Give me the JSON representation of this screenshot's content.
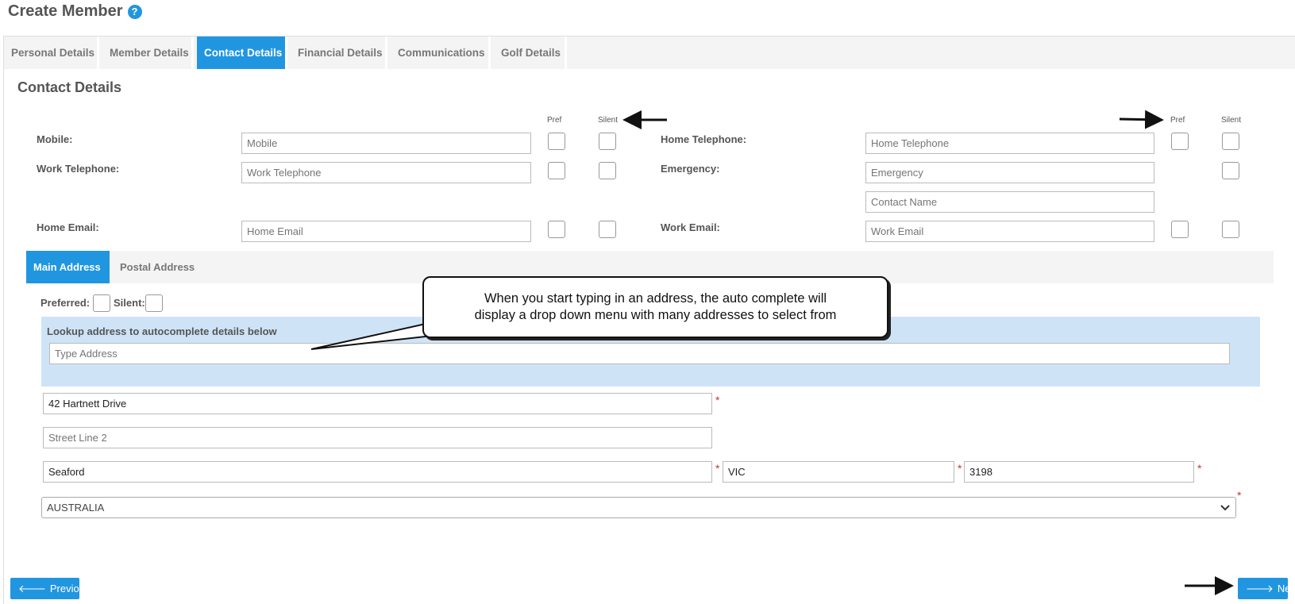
{
  "header": {
    "title": "Create Member",
    "help_icon": "question-circle-icon"
  },
  "tabs": [
    {
      "label": "Personal Details",
      "active": false
    },
    {
      "label": "Member Details",
      "active": false
    },
    {
      "label": "Contact Details",
      "active": true
    },
    {
      "label": "Financial Details",
      "active": false
    },
    {
      "label": "Communications",
      "active": false
    },
    {
      "label": "Golf Details",
      "active": false
    }
  ],
  "section_title": "Contact Details",
  "columns": {
    "pref": "Pref",
    "silent": "Silent"
  },
  "contact": {
    "mobile": {
      "label": "Mobile:",
      "placeholder": "Mobile"
    },
    "work_telephone": {
      "label": "Work Telephone:",
      "placeholder": "Work Telephone"
    },
    "home_email": {
      "label": "Home Email:",
      "placeholder": "Home Email"
    },
    "home_telephone": {
      "label": "Home Telephone:",
      "placeholder": "Home Telephone"
    },
    "emergency": {
      "label": "Emergency:",
      "placeholder": "Emergency",
      "contact_name_placeholder": "Contact Name"
    },
    "work_email": {
      "label": "Work Email:",
      "placeholder": "Work Email"
    }
  },
  "address_tabs": [
    {
      "label": "Main Address",
      "active": true
    },
    {
      "label": "Postal Address",
      "active": false
    }
  ],
  "address": {
    "preferred_label": "Preferred:",
    "silent_label": "Silent:",
    "lookup_label": "Lookup address to autocomplete details below",
    "lookup_placeholder": "Type Address",
    "street1": "42 Hartnett Drive",
    "street2_placeholder": "Street Line 2",
    "suburb": "Seaford",
    "state": "VIC",
    "postcode": "3198",
    "country": "AUSTRALIA",
    "required_mark": "*"
  },
  "callout": {
    "line1": "When you start typing in an address, the auto complete will",
    "line2": "display a drop down menu with many addresses to select from"
  },
  "buttons": {
    "previous": "Previous",
    "next": "Next"
  },
  "colors": {
    "accent": "#2196e0",
    "lookup_bg": "#cfe3f7",
    "required": "#c0392b"
  }
}
